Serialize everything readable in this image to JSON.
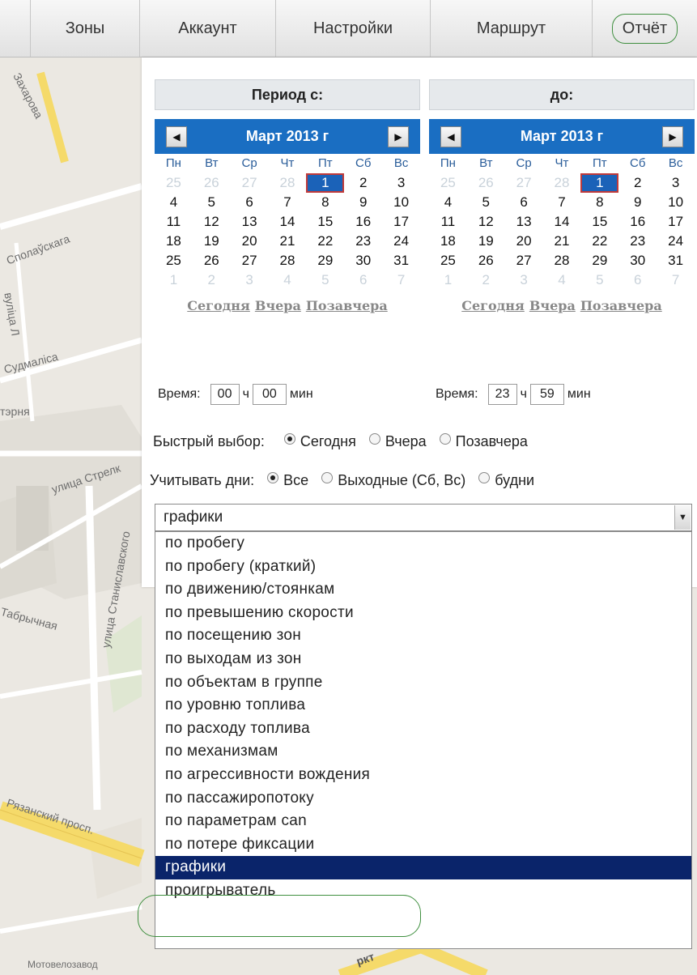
{
  "nav": {
    "tabs": [
      {
        "label": "Зоны"
      },
      {
        "label": "Аккаунт"
      },
      {
        "label": "Настройки"
      },
      {
        "label": "Маршрут"
      },
      {
        "label": "Отчёт"
      }
    ]
  },
  "map": {
    "labels": [
      "Захарова",
      "Сполаўскага",
      "вуліца Л",
      "Судмаліса",
      "тэрня",
      "улица Стрелк",
      "улица Станиславского",
      "Табрычная",
      "Рязанский просп.",
      "Мотовелозавод",
      "ркт"
    ]
  },
  "period": {
    "from_label": "Период с:",
    "to_label": "до:",
    "from_calendar": {
      "title": "Март 2013 г",
      "weekdays": [
        "Пн",
        "Вт",
        "Ср",
        "Чт",
        "Пт",
        "Сб",
        "Вс"
      ],
      "days": [
        "25",
        "26",
        "27",
        "28",
        "1",
        "2",
        "3",
        "4",
        "5",
        "6",
        "7",
        "8",
        "9",
        "10",
        "11",
        "12",
        "13",
        "14",
        "15",
        "16",
        "17",
        "18",
        "19",
        "20",
        "21",
        "22",
        "23",
        "24",
        "25",
        "26",
        "27",
        "28",
        "29",
        "30",
        "31",
        "1",
        "2",
        "3",
        "4",
        "5",
        "6",
        "7"
      ],
      "selected_index": 4,
      "quick_links": [
        "Сегодня",
        "Вчера",
        "Позавчера"
      ]
    },
    "to_calendar": {
      "title": "Март 2013 г",
      "weekdays": [
        "Пн",
        "Вт",
        "Ср",
        "Чт",
        "Пт",
        "Сб",
        "Вс"
      ],
      "days": [
        "25",
        "26",
        "27",
        "28",
        "1",
        "2",
        "3",
        "4",
        "5",
        "6",
        "7",
        "8",
        "9",
        "10",
        "11",
        "12",
        "13",
        "14",
        "15",
        "16",
        "17",
        "18",
        "19",
        "20",
        "21",
        "22",
        "23",
        "24",
        "25",
        "26",
        "27",
        "28",
        "29",
        "30",
        "31",
        "1",
        "2",
        "3",
        "4",
        "5",
        "6",
        "7"
      ],
      "selected_index": 4,
      "quick_links": [
        "Сегодня",
        "Вчера",
        "Позавчера"
      ]
    },
    "from_time": {
      "label": "Время:",
      "hours": "00",
      "h_unit": "ч",
      "minutes": "00",
      "m_unit": "мин"
    },
    "to_time": {
      "label": "Время:",
      "hours": "23",
      "h_unit": "ч",
      "minutes": "59",
      "m_unit": "мин"
    }
  },
  "quick_select": {
    "label": "Быстрый выбор:",
    "options": [
      "Сегодня",
      "Вчера",
      "Позавчера"
    ],
    "selected": 0
  },
  "days_filter": {
    "label": "Учитывать дни:",
    "options": [
      "Все",
      "Выходные (Сб, Вс)",
      "будни"
    ],
    "selected": 0
  },
  "report_select": {
    "value": "графики",
    "options": [
      "по пробегу",
      "по пробегу (краткий)",
      "по движению/стоянкам",
      "по превышению скорости",
      "по посещению зон",
      "по выходам из зон",
      "по объектам в группе",
      "по уровню топлива",
      "по расходу топлива",
      "по механизмам",
      "по агрессивности вождения",
      "по пассажиропотоку",
      "по параметрам can",
      "по потере фиксации",
      "графики",
      "проигрыватель"
    ],
    "highlighted_index": 14
  }
}
